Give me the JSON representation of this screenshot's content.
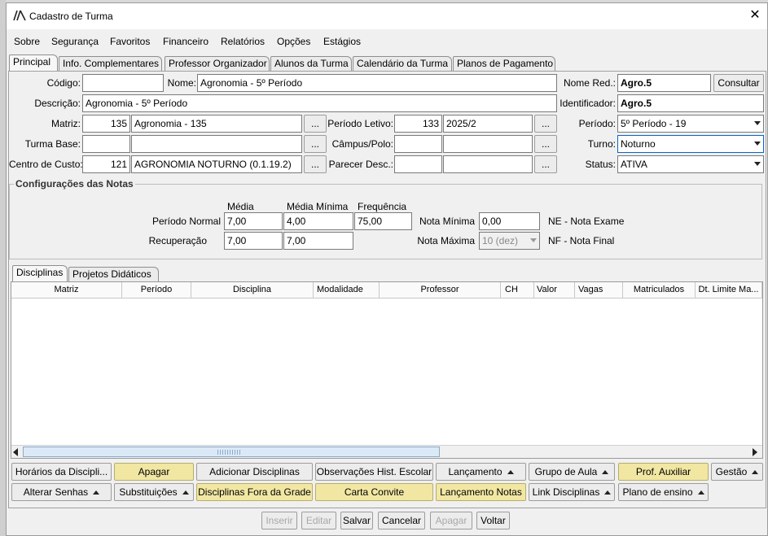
{
  "window": {
    "title": "Cadastro de Turma",
    "close_icon": "close-icon"
  },
  "menu": [
    "Sobre",
    "Segurança",
    "Favoritos",
    "Financeiro",
    "Relatórios",
    "Opções",
    "Estágios"
  ],
  "tabs": [
    "Principal",
    "Info. Complementares",
    "Professor Organizador",
    "Alunos da Turma",
    "Calendário da Turma",
    "Planos de Pagamento"
  ],
  "form": {
    "codigo_label": "Código:",
    "codigo_value": "",
    "nome_label": "Nome:",
    "nome_value": "Agronomia - 5º Período",
    "nome_red_label": "Nome Red.:",
    "nome_red_value": "Agro.5",
    "consultar_label": "Consultar",
    "descricao_label": "Descrição:",
    "descricao_value": "Agronomia - 5º Período",
    "identificador_label": "Identificador:",
    "identificador_value": "Agro.5",
    "matriz_label": "Matriz:",
    "matriz_code": "135",
    "matriz_name": "Agronomia - 135",
    "periodo_letivo_label": "Período Letivo:",
    "periodo_letivo_code": "133",
    "periodo_letivo_name": "2025/2",
    "periodo_label": "Período:",
    "periodo_value": "5º Período - 19",
    "turma_base_label": "Turma Base:",
    "turma_base_code": "",
    "turma_base_name": "",
    "campus_label": "Câmpus/Polo:",
    "campus_code": "",
    "campus_name": "",
    "turno_label": "Turno:",
    "turno_value": "Noturno",
    "centro_custo_label": "Centro de Custo:",
    "centro_custo_code": "121",
    "centro_custo_name": "AGRONOMIA NOTURNO (0.1.19.2)",
    "parecer_label": "Parecer Desc.:",
    "parecer_code": "",
    "parecer_name": "",
    "status_label": "Status:",
    "status_value": "ATIVA",
    "lookup_label": "..."
  },
  "notas": {
    "group_title": "Configurações das Notas",
    "col_media": "Média",
    "col_media_minima": "Média Mínima",
    "col_frequencia": "Frequência",
    "periodo_normal_label": "Período Normal",
    "pn_media": "7,00",
    "pn_media_minima": "4,00",
    "pn_frequencia": "75,00",
    "recuperacao_label": "Recuperação",
    "rec_media": "7,00",
    "rec_media_minima": "7,00",
    "nota_minima_label": "Nota Mínima",
    "nota_minima_value": "0,00",
    "nota_maxima_label": "Nota Máxima",
    "nota_maxima_value": "10 (dez)",
    "ne_text": "NE - Nota Exame",
    "nf_text": "NF - Nota Final"
  },
  "subtabs": [
    "Disciplinas",
    "Projetos Didáticos"
  ],
  "grid_columns": [
    "Matriz",
    "Período",
    "Disciplina",
    "Modalidade",
    "Professor",
    "CH",
    "Valor",
    "Vagas",
    "Matriculados",
    "Dt. Limite Ma..."
  ],
  "actions_row1": [
    {
      "label": "Horários da Discipli...",
      "menu": false
    },
    {
      "label": "Apagar",
      "menu": false
    },
    {
      "label": "Adicionar Disciplinas",
      "menu": false
    },
    {
      "label": "Observações Hist. Escolar",
      "menu": false
    },
    {
      "label": "Lançamento",
      "menu": true
    },
    {
      "label": "Grupo de Aula",
      "menu": true
    },
    {
      "label": "Prof. Auxiliar",
      "menu": false
    },
    {
      "label": "Gestão",
      "menu": true
    }
  ],
  "actions_row2": [
    {
      "label": "Alterar Senhas",
      "menu": true
    },
    {
      "label": "Substituições",
      "menu": true
    },
    {
      "label": "Disciplinas Fora da Grade",
      "menu": false
    },
    {
      "label": "Carta Convite",
      "menu": false
    },
    {
      "label": "Lançamento Notas",
      "menu": false
    },
    {
      "label": "Link Disciplinas",
      "menu": true
    },
    {
      "label": "Plano de ensino",
      "menu": true
    }
  ],
  "footer": [
    "Inserir",
    "Editar",
    "Salvar",
    "Cancelar",
    "Apagar",
    "Voltar"
  ],
  "colors": {
    "highlight_yellow": "#f1e7a3",
    "focus_blue": "#0a64c8",
    "scroll_thumb": "#dbe9f7"
  }
}
